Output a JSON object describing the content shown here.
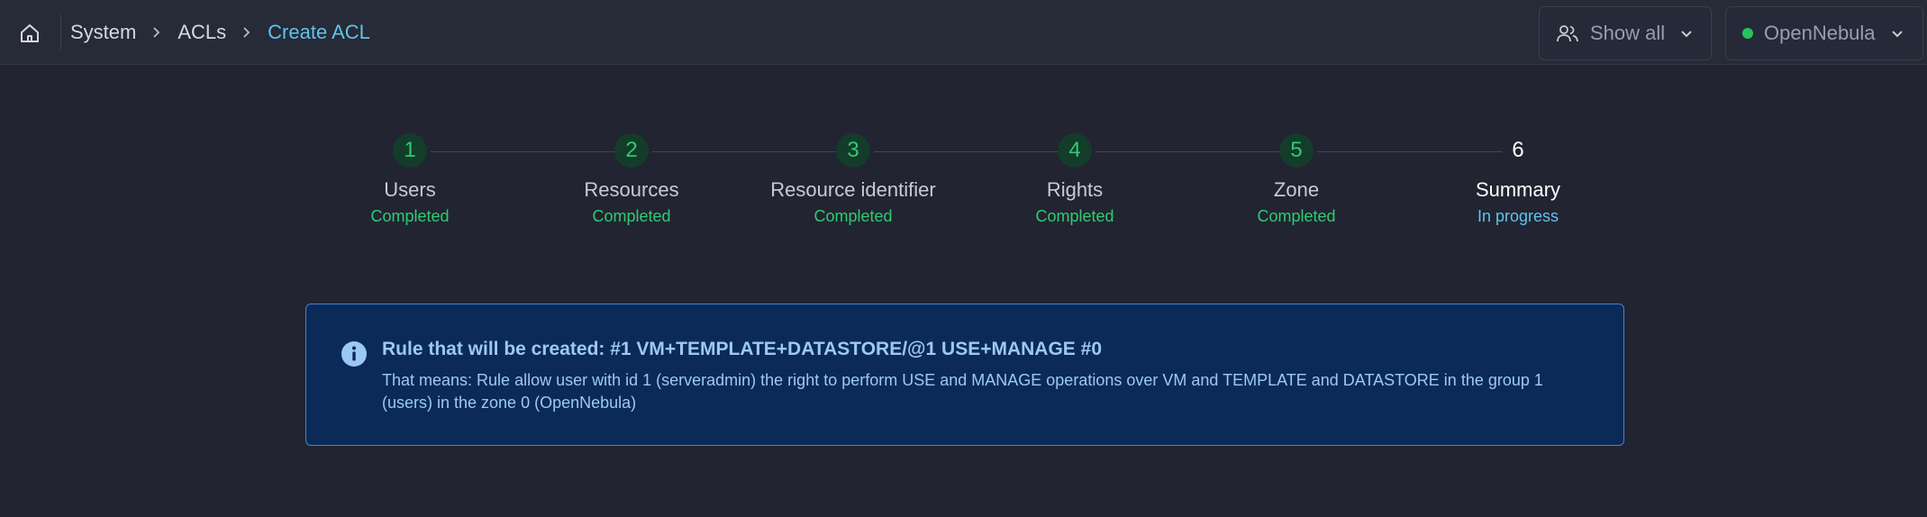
{
  "breadcrumb": {
    "items": [
      "System",
      "ACLs"
    ],
    "current": "Create ACL"
  },
  "header": {
    "filter_label": "Show all",
    "zone_label": "OpenNebula",
    "zone_status_color": "#27c25b"
  },
  "stepper": {
    "steps": [
      {
        "number": "1",
        "title": "Users",
        "status": "Completed"
      },
      {
        "number": "2",
        "title": "Resources",
        "status": "Completed"
      },
      {
        "number": "3",
        "title": "Resource identifier",
        "status": "Completed"
      },
      {
        "number": "4",
        "title": "Rights",
        "status": "Completed"
      },
      {
        "number": "5",
        "title": "Zone",
        "status": "Completed"
      },
      {
        "number": "6",
        "title": "Summary",
        "status": "In progress"
      }
    ]
  },
  "summary": {
    "title": "Rule that will be created: #1 VM+TEMPLATE+DATASTORE/@1 USE+MANAGE #0",
    "description": "That means: Rule allow user with id 1 (serveradmin) the right to perform USE and MANAGE operations over VM and TEMPLATE and DATASTORE in the group 1 (users) in the zone 0 (OpenNebula)"
  },
  "colors": {
    "completed": "#2ecc71",
    "in_progress": "#5fc3ea",
    "info_background": "#0c2a57"
  }
}
